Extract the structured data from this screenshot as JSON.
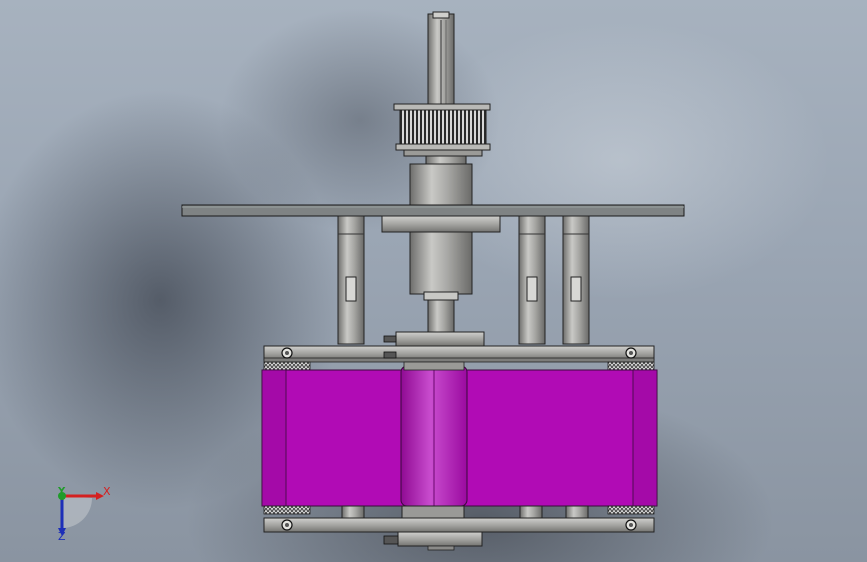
{
  "viewport": {
    "background_colors": {
      "light": "#a7b2bf",
      "dark": "#1e232d"
    },
    "part_colors": {
      "belt": "#b10bb5",
      "belt_highlight": "#c93ccf",
      "metal": "#a8a8a6",
      "plate": "#7f8384",
      "edge": "#1a1a1a"
    }
  },
  "triad": {
    "x_label": "X",
    "y_label": "Y",
    "z_label": "Z",
    "x_color": "#d42020",
    "y_color": "#1f9b2a",
    "z_color": "#1d2fb8"
  }
}
